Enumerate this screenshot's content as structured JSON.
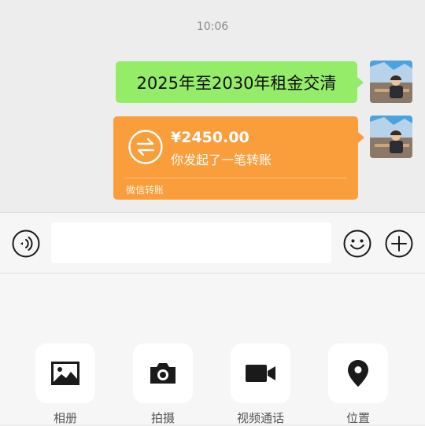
{
  "chat": {
    "time": "10:06",
    "message_text": "2025年至2030年租金交清",
    "transfer": {
      "amount": "¥2450.00",
      "description": "你发起了一笔转账",
      "footer": "微信转账"
    }
  },
  "input_bar": {
    "value": "",
    "voice_icon": "voice-icon",
    "emoji_icon": "emoji-icon",
    "plus_icon": "plus-icon"
  },
  "tools": [
    {
      "label": "相册",
      "icon": "album-icon"
    },
    {
      "label": "拍摄",
      "icon": "camera-icon"
    },
    {
      "label": "视频通话",
      "icon": "video-call-icon"
    },
    {
      "label": "位置",
      "icon": "location-icon"
    }
  ],
  "colors": {
    "chat_background": "#ededed",
    "sent_bubble": "#95ec69",
    "transfer_bubble": "#fa9d3b",
    "panel_background": "#f6f6f6"
  }
}
